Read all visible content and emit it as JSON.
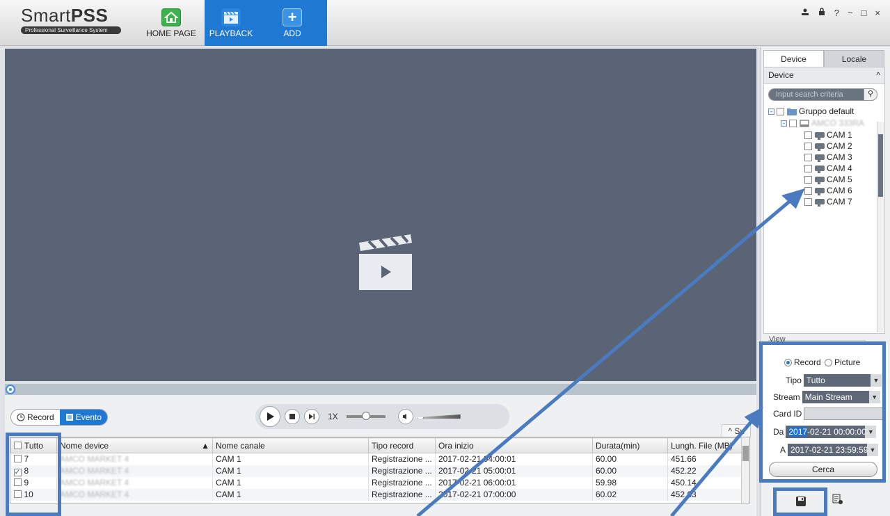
{
  "app": {
    "logo_name_light": "Smart",
    "logo_name_bold": "PSS",
    "logo_tagline": "Professional Surveillance System"
  },
  "nav": {
    "home": "HOME PAGE",
    "playback": "PLAYBACK",
    "add": "ADD"
  },
  "window_controls": [
    "user-icon",
    "lock-icon",
    "?",
    "−",
    "□",
    "×"
  ],
  "bottom": {
    "mode_record": "Record",
    "mode_evento": "Evento",
    "speed": "1X",
    "collapse_label": "Su"
  },
  "table": {
    "headers": [
      "Tutto",
      "Nome device",
      "Nome canale",
      "Tipo record",
      "Ora inizio",
      "Durata(min)",
      "Lungh. File (MB)"
    ],
    "rows": [
      {
        "num": "7",
        "checked": false,
        "device": "AMCO MARKET 4",
        "channel": "CAM 1",
        "type": "Registrazione ...",
        "start": "2017-02-21 04:00:01",
        "duration": "60.00",
        "size": "451.66"
      },
      {
        "num": "8",
        "checked": true,
        "device": "AMCO MARKET 4",
        "channel": "CAM 1",
        "type": "Registrazione ...",
        "start": "2017-02-21 05:00:01",
        "duration": "60.00",
        "size": "452.22"
      },
      {
        "num": "9",
        "checked": false,
        "device": "AMCO MARKET 4",
        "channel": "CAM 1",
        "type": "Registrazione ...",
        "start": "2017-02-21 06:00:01",
        "duration": "59.98",
        "size": "450.14"
      },
      {
        "num": "10",
        "checked": false,
        "device": "AMCO MARKET 4",
        "channel": "CAM 1",
        "type": "Registrazione ...",
        "start": "2017-02-21 07:00:00",
        "duration": "60.02",
        "size": "452.63"
      }
    ]
  },
  "right": {
    "tab_device": "Device",
    "tab_locale": "Locale",
    "section_device": "Device",
    "search_placeholder": "Input search criteria",
    "group": "Gruppo default",
    "device_name": "AMCO 333RA",
    "cams": [
      "CAM 1",
      "CAM 2",
      "CAM 3",
      "CAM 4",
      "CAM 5",
      "CAM 6",
      "CAM 7"
    ],
    "section_view": "View"
  },
  "filter": {
    "record": "Record",
    "picture": "Picture",
    "tipo_label": "Tipo",
    "tipo_value": "Tutto",
    "stream_label": "Stream",
    "stream_value": "Main Stream",
    "cardid_label": "Card ID",
    "da_label": "Da",
    "da_value_hl": "2017",
    "da_value_rest": "-02-21 00:00:00",
    "a_label": "A",
    "a_value": "2017-02-21 23:59:59",
    "search_button": "Cerca"
  },
  "colors": {
    "accent": "#1f78d1",
    "video_bg": "#5b6474",
    "annotation": "#4a7bc0"
  }
}
